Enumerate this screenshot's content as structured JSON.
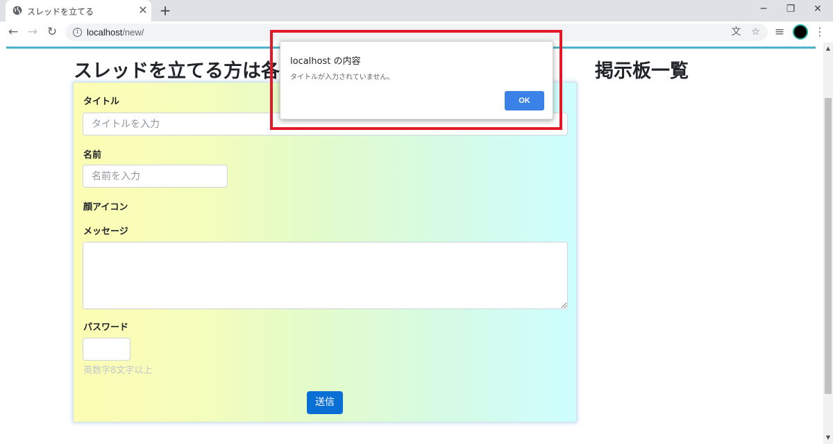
{
  "browser": {
    "tab_title": "スレッドを立てる",
    "tab_close": "✕",
    "new_tab": "+",
    "window_minimize": "─",
    "window_restore": "❐",
    "window_close": "✕",
    "url_host": "localhost",
    "url_path": "/new/",
    "back_glyph": "←",
    "forward_glyph": "→",
    "reload_glyph": "↻",
    "info_glyph": "i",
    "translate_glyph": "文",
    "bookmark_glyph": "☆",
    "media_glyph": "≡",
    "menu_glyph": "⋮",
    "profile_color": "#000000",
    "icons": [
      "globe-icon",
      "back-arrow-icon",
      "forward-arrow-icon",
      "reload-icon",
      "info-icon",
      "translate-icon",
      "star-icon",
      "media-queue-icon",
      "profile-avatar",
      "kebab-menu-icon"
    ]
  },
  "page": {
    "heading": "スレッドを立てる方は各",
    "sidebar_heading": "掲示板一覧",
    "form": {
      "title_label": "タイトル",
      "title_placeholder": "タイトルを入力",
      "name_label": "名前",
      "name_placeholder": "名前を入力",
      "icon_label": "顔アイコン",
      "message_label": "メッセージ",
      "message_value": "",
      "password_label": "パスワード",
      "password_value": "",
      "password_hint": "英数字8文字以上",
      "submit_label": "送信"
    },
    "colors": {
      "accent_line": "#4fb3c8",
      "submit_bg": "#0a6fd4",
      "gradient_start": "#fdfdb4",
      "gradient_end": "#cefeff",
      "highlight_border": "#e3192a"
    }
  },
  "dialog": {
    "title": "localhost の内容",
    "message": "タイトルが入力されていません。",
    "ok_label": "OK"
  }
}
